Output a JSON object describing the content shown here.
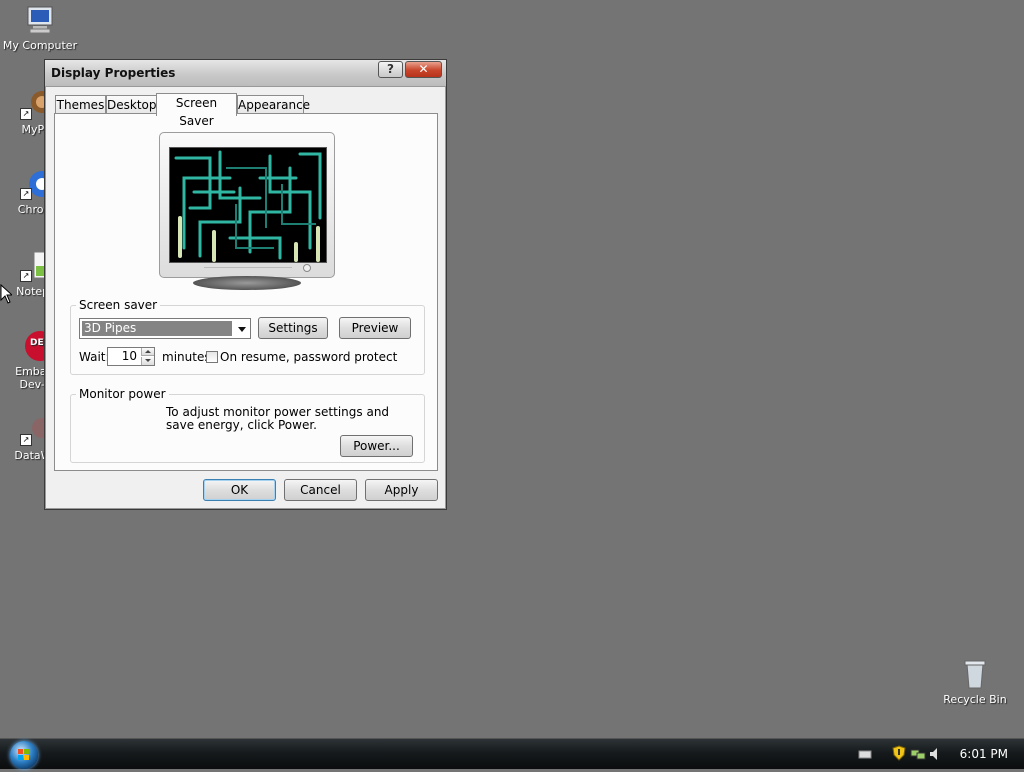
{
  "desktop": {
    "icons": [
      {
        "label": "My Computer"
      },
      {
        "label": "MyPa"
      },
      {
        "label": "Chrom"
      },
      {
        "label": "Notepa"
      },
      {
        "label": "Embarc"
      },
      {
        "label": "Dev-C"
      },
      {
        "label": "DataWa"
      },
      {
        "label": "Recycle Bin"
      }
    ],
    "dev_icon_text": "DEV"
  },
  "window": {
    "title": "Display Properties",
    "help_glyph": "?",
    "close_glyph": "✕",
    "tabs": [
      {
        "label": "Themes"
      },
      {
        "label": "Desktop"
      },
      {
        "label": "Screen Saver"
      },
      {
        "label": "Appearance"
      }
    ],
    "screen_saver": {
      "group_label": "Screen saver",
      "selected": "3D Pipes",
      "settings_label": "Settings",
      "preview_label": "Preview",
      "wait_label": "Wait:",
      "wait_value": "10",
      "minutes_label": "minutes",
      "password_label": "On resume, password protect",
      "password_checked": false
    },
    "monitor_power": {
      "group_label": "Monitor power",
      "text": "To adjust monitor power settings and save energy, click Power.",
      "power_label": "Power..."
    },
    "buttons": {
      "ok": "OK",
      "cancel": "Cancel",
      "apply": "Apply"
    }
  },
  "taskbar": {
    "clock": "6:01 PM"
  },
  "colors": {
    "desktop": "#747474",
    "pipe": "#2fb7a4",
    "taskbar": "#161a1c"
  }
}
